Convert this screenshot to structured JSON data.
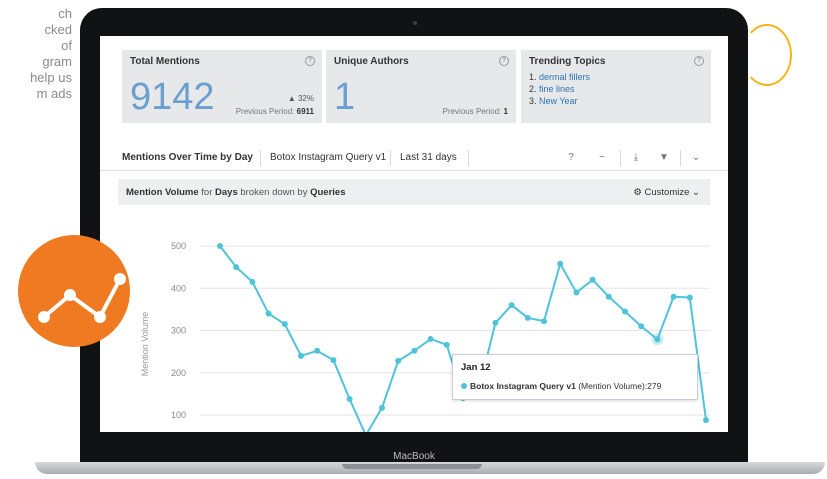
{
  "sidebar_text": [
    "ch",
    "cked",
    "of",
    "gram",
    "help us",
    "m ads"
  ],
  "colors": {
    "accent": "#6a9fcf",
    "series": "#4fc3d8",
    "orange": "#f07a22",
    "yellow": "#f6b51c"
  },
  "cards": {
    "total": {
      "title": "Total Mentions",
      "value": "9142",
      "delta": "▲ 32%",
      "prev_label": "Previous Period:",
      "prev_value": "6911"
    },
    "authors": {
      "title": "Unique Authors",
      "value": "1",
      "prev_label": "Previous Period:",
      "prev_value": "1"
    },
    "topics": {
      "title": "Trending Topics",
      "items": [
        {
          "num": "1.",
          "label": "dermal fillers"
        },
        {
          "num": "2.",
          "label": "fine lines"
        },
        {
          "num": "3.",
          "label": "New Year"
        }
      ]
    }
  },
  "tabs": {
    "t1": "Mentions Over Time by Day",
    "t2": "Botox Instagram Query v1",
    "t3": "Last 31 days"
  },
  "subheader": {
    "p1": "Mention Volume",
    "p2": " for ",
    "p3": "Days",
    "p4": " broken down by ",
    "p5": "Queries",
    "customize": "Customize"
  },
  "laptop": {
    "brand": "MacBook"
  },
  "chart_data": {
    "type": "line",
    "ylabel": "Mention Volume",
    "yticks": [
      100,
      200,
      300,
      400,
      500
    ],
    "series": [
      {
        "name": "Botox Instagram Query v1 (Mention Volume)",
        "values": [
          500,
          450,
          415,
          340,
          315,
          240,
          252,
          230,
          138,
          52,
          117,
          228,
          252,
          280,
          266,
          140,
          162,
          318,
          360,
          330,
          322,
          458,
          390,
          420,
          380,
          345,
          310,
          279,
          380,
          378,
          88
        ]
      }
    ],
    "tooltip": {
      "date": "Jan 12",
      "series": "Botox Instagram Query v1",
      "metric": "(Mention Volume):",
      "value": "279",
      "index": 27
    }
  }
}
